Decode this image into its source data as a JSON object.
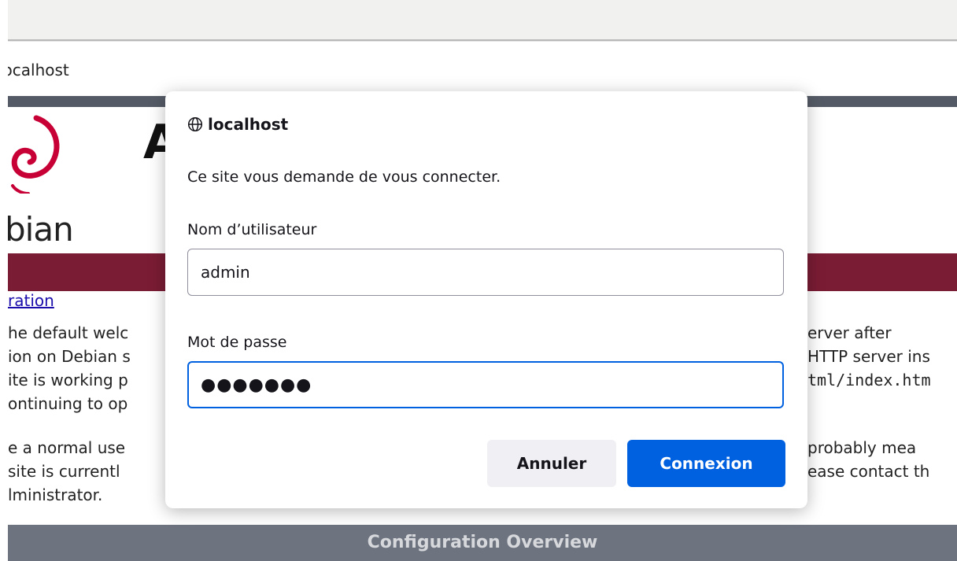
{
  "browser": {
    "url": "localhost"
  },
  "background_page": {
    "big_letter": "A",
    "logo_text": "bian",
    "link_text": "ration",
    "paragraph1_left": [
      "he default welc",
      "ion on Debian s",
      "ite is working p",
      "ontinuing to op"
    ],
    "paragraph1_right": [
      "erver after",
      "HTTP server ins",
      "tml/index.htm",
      ""
    ],
    "paragraph2_left": [
      "e a normal use",
      " site is currentl",
      "lministrator."
    ],
    "paragraph2_right": [
      " probably mea",
      "ease contact th",
      ""
    ],
    "section_title": "Configuration Overview",
    "colors": {
      "banner": "#7a1c34",
      "header_border": "#555b66",
      "section_bar": "#6d7480",
      "logo": "#c70036"
    }
  },
  "dialog": {
    "origin": "localhost",
    "origin_icon": "globe-icon",
    "message": "Ce site vous demande de vous connecter.",
    "username_label": "Nom d’utilisateur",
    "username_value": "admin",
    "password_label": "Mot de passe",
    "password_value": "●●●●●●●",
    "cancel_label": "Annuler",
    "ok_label": "Connexion",
    "colors": {
      "accent": "#0061e0",
      "cancel_bg": "#f0f0f4"
    }
  }
}
